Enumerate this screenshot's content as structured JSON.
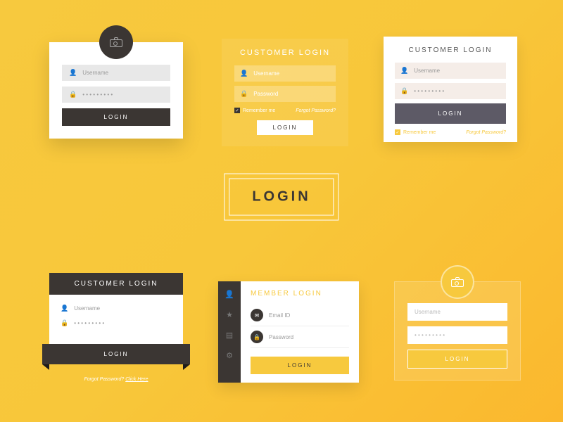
{
  "center": {
    "label": "LOGIN"
  },
  "panel1": {
    "username_placeholder": "Username",
    "password_value": "• • • • • • • • •",
    "login_label": "LOGIN"
  },
  "panel2": {
    "title": "CUSTOMER LOGIN",
    "username_placeholder": "Username",
    "password_placeholder": "Password",
    "remember_label": "Remember me",
    "forgot_label": "Forgot Password?",
    "login_label": "LOGIN"
  },
  "panel3": {
    "title": "CUSTOMER LOGIN",
    "username_placeholder": "Username",
    "password_value": "• • • • • • • • •",
    "login_label": "LOGIN",
    "remember_label": "Remember me",
    "forgot_label": "Forgot Password?"
  },
  "panel4": {
    "title": "CUSTOMER LOGIN",
    "username_placeholder": "Username",
    "password_value": "• • • • • • • • •",
    "login_label": "LOGIN",
    "forgot_prefix": "Forgot Password? ",
    "forgot_link": "Click Here"
  },
  "panel5": {
    "title": "MEMBER LOGIN",
    "email_placeholder": "Email ID",
    "password_placeholder": "Password",
    "login_label": "LOGIN"
  },
  "panel6": {
    "username_placeholder": "Username",
    "password_value": "• • • • • • • • •",
    "login_label": "LOGIN"
  }
}
